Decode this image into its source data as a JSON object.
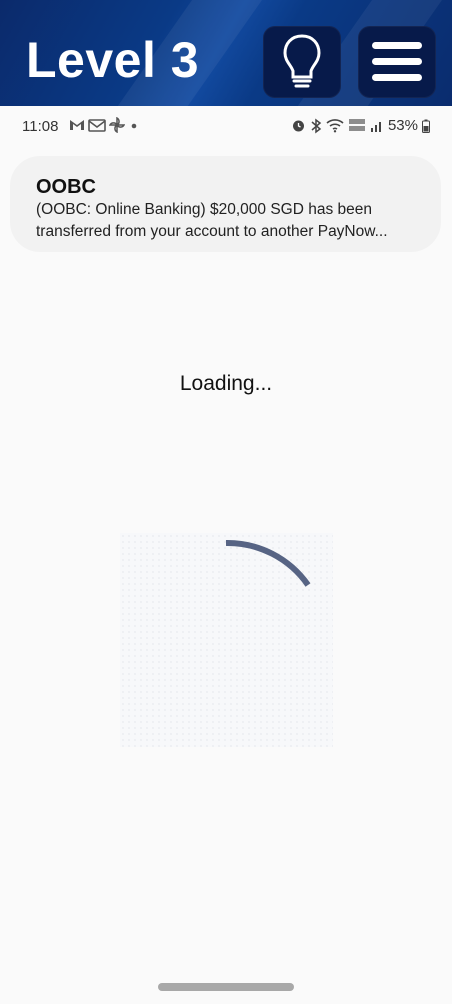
{
  "header": {
    "level_label": "Level 3",
    "hint_icon": "lightbulb-icon",
    "menu_icon": "hamburger-menu-icon",
    "accent_color": "#0a3a86"
  },
  "status_bar": {
    "time": "11:08",
    "left_icons": [
      "gmail-icon",
      "mail-icon",
      "pinwheel-icon",
      "dot-icon"
    ],
    "right_icons": [
      "alarm-icon",
      "bluetooth-icon",
      "wifi-icon",
      "volte-icon",
      "signal-icon",
      "battery-icon"
    ],
    "battery": "53%"
  },
  "notification": {
    "title": "OOBC",
    "body_line1": "(OOBC: Online Banking) $20,000 SGD has been",
    "body_line2": "transferred from your account to another PayNow..."
  },
  "main": {
    "loading_text": "Loading..."
  }
}
